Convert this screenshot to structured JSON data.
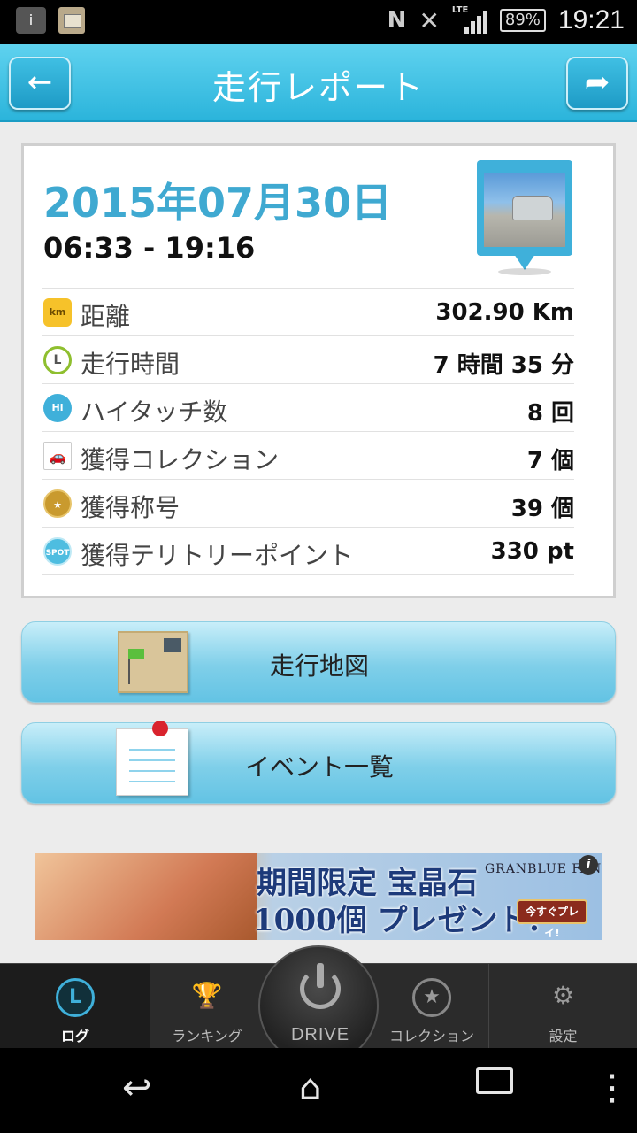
{
  "status_bar": {
    "info_icon": "info-icon",
    "network": "LTE",
    "battery": "89%",
    "time": "19:21"
  },
  "header": {
    "title": "走行レポート",
    "back_icon": "←",
    "share_icon": "➦"
  },
  "report": {
    "date": "2015年07月30日",
    "time_range": "06:33 - 19:16",
    "stats": [
      {
        "icon": "km",
        "label": "距離",
        "value": "302.90 Km"
      },
      {
        "icon": "clock",
        "label": "走行時間",
        "value": "7 時間 35 分"
      },
      {
        "icon": "hi-five",
        "label": "ハイタッチ数",
        "value": "8 回"
      },
      {
        "icon": "car",
        "label": "獲得コレクション",
        "value": "7 個"
      },
      {
        "icon": "medal",
        "label": "獲得称号",
        "value": "39 個"
      },
      {
        "icon": "SPOT",
        "label": "獲得テリトリーポイント",
        "value": "330 pt"
      }
    ]
  },
  "actions": {
    "map_label": "走行地図",
    "events_label": "イベント一覧"
  },
  "ad": {
    "line1": "期間限定 宝晶石",
    "brand": "GRANBLUE FANTA",
    "line2": "1000個 プレゼント!",
    "cta": "今すぐプレイ!",
    "info": "i"
  },
  "tabs": {
    "log": "ログ",
    "ranking": "ランキング",
    "drive": "DRIVE",
    "collection": "コレクション",
    "settings": "設定"
  },
  "colors": {
    "accent": "#3fa9d1",
    "header": "#2bb4db",
    "tabbar": "#2b2b2b"
  }
}
